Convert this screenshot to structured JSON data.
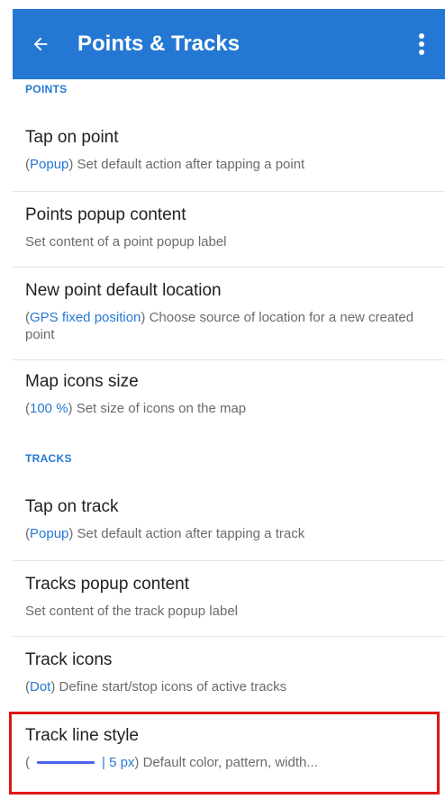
{
  "app_bar": {
    "title": "Points & Tracks",
    "back_icon": "arrow-left-icon",
    "menu_icon": "overflow-menu-icon",
    "color": "#2478d4"
  },
  "sections": {
    "points": "POINTS",
    "tracks": "TRACKS"
  },
  "items": {
    "tap_on_point": {
      "title": "Tap on point",
      "value": "Popup",
      "desc": " Set default action after tapping a point"
    },
    "points_popup_content": {
      "title": "Points popup content",
      "desc": "Set content of a point popup label"
    },
    "new_point_default_location": {
      "title": "New point default location",
      "value": "GPS fixed position",
      "desc": " Choose source of location for a new created point"
    },
    "map_icons_size": {
      "title": "Map icons size",
      "value": "100 %",
      "desc": " Set size of icons on the map"
    },
    "tap_on_track": {
      "title": "Tap on track",
      "value": "Popup",
      "desc": " Set default action after tapping a track"
    },
    "tracks_popup_content": {
      "title": "Tracks popup content",
      "desc": "Set content of the track popup label"
    },
    "track_icons": {
      "title": "Track icons",
      "value": "Dot",
      "desc": " Define start/stop icons of active tracks"
    },
    "track_line_style": {
      "title": "Track line style",
      "value": "| 5 px",
      "desc": " Default color, pattern, width...",
      "line_color": "#4a64f0"
    }
  }
}
